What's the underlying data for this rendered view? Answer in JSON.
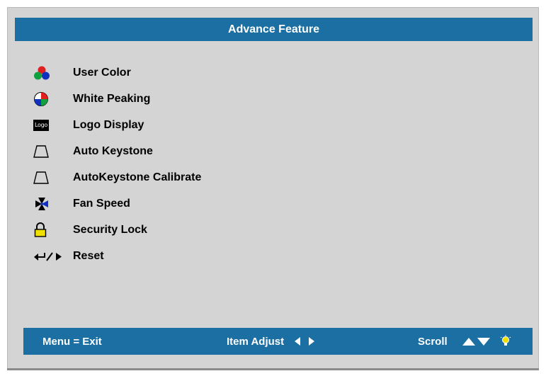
{
  "title": "Advance Feature",
  "menu": {
    "items": [
      {
        "label": "User Color",
        "icon": "user-color-icon"
      },
      {
        "label": "White Peaking",
        "icon": "white-peaking-icon"
      },
      {
        "label": "Logo Display",
        "icon": "logo-icon",
        "icon_text": "Logo"
      },
      {
        "label": "Auto Keystone",
        "icon": "keystone-icon"
      },
      {
        "label": "AutoKeystone Calibrate",
        "icon": "keystone-icon"
      },
      {
        "label": "Fan Speed",
        "icon": "fan-icon"
      },
      {
        "label": "Security Lock",
        "icon": "lock-icon"
      },
      {
        "label": "Reset",
        "icon": "enter-icon"
      }
    ]
  },
  "footer": {
    "exit_label": "Menu = Exit",
    "adjust_label": "Item Adjust",
    "scroll_label": "Scroll"
  },
  "colors": {
    "panel": "#d4d4d4",
    "bar": "#1b6fa3",
    "icon_red": "#e02020",
    "icon_green": "#10a040",
    "icon_blue": "#1030c0",
    "lock_yellow": "#f0e000"
  }
}
